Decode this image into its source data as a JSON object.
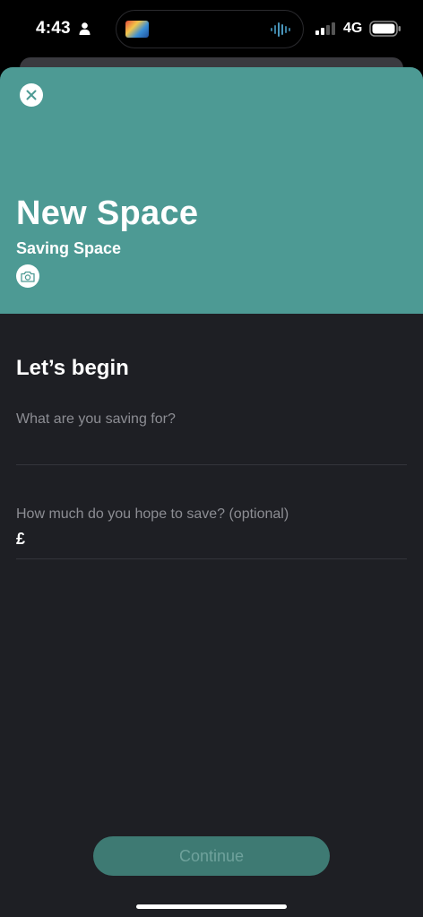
{
  "status_bar": {
    "time": "4:43",
    "network": "4G",
    "icons": [
      "person-icon",
      "signal-icon",
      "battery-icon"
    ]
  },
  "header": {
    "title": "New Space",
    "subtitle": "Saving Space",
    "close_icon": "close-icon",
    "camera_icon": "camera-icon",
    "background_color": "#4d9a94"
  },
  "form": {
    "heading": "Let’s begin",
    "goal": {
      "placeholder": "What are you saving for?",
      "value": ""
    },
    "amount": {
      "label": "How much do you hope to save? (optional)",
      "currency": "£",
      "value": ""
    }
  },
  "actions": {
    "continue_label": "Continue",
    "continue_color": "#3e7a73"
  }
}
